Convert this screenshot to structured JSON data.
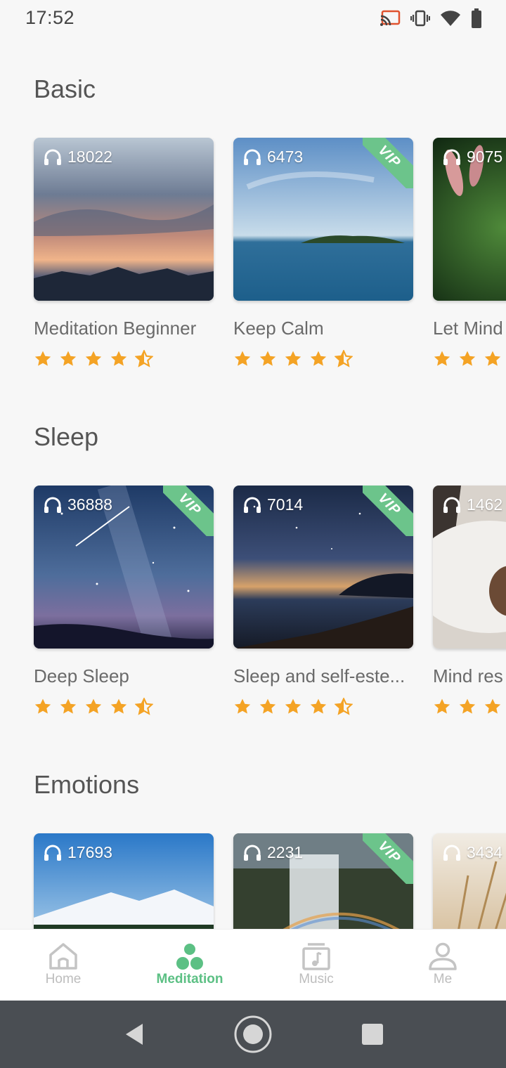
{
  "status_bar": {
    "time": "17:52",
    "icons": [
      "cast-icon",
      "vibrate-icon",
      "wifi-icon",
      "battery-icon"
    ]
  },
  "sections": [
    {
      "title": "Basic",
      "cards": [
        {
          "title": "Meditation Beginner",
          "plays": "18022",
          "vip": false,
          "rating": 4.5,
          "image": "mountain-sunset"
        },
        {
          "title": "Keep Calm",
          "plays": "6473",
          "vip": true,
          "rating": 4.5,
          "image": "ocean-island"
        },
        {
          "title": "Let Mind",
          "plays": "9075",
          "vip": false,
          "rating": 4.5,
          "image": "green-leaves"
        }
      ]
    },
    {
      "title": "Sleep",
      "cards": [
        {
          "title": "Deep Sleep",
          "plays": "36888",
          "vip": true,
          "rating": 4.5,
          "image": "starry-sky"
        },
        {
          "title": "Sleep and self-este...",
          "plays": "7014",
          "vip": true,
          "rating": 4.5,
          "image": "night-beach"
        },
        {
          "title": "Mind res",
          "plays": "1462",
          "vip": false,
          "rating": 4.5,
          "image": "pillow"
        }
      ]
    },
    {
      "title": "Emotions",
      "cards": [
        {
          "title": "",
          "plays": "17693",
          "vip": false,
          "rating": 0,
          "image": "snowy-mountains"
        },
        {
          "title": "",
          "plays": "2231",
          "vip": true,
          "rating": 0,
          "image": "waterfall-rainbow"
        },
        {
          "title": "",
          "plays": "3434",
          "vip": false,
          "rating": 0,
          "image": "wheat-field"
        }
      ]
    }
  ],
  "vip_label": "VIP",
  "bottom_nav": {
    "items": [
      {
        "label": "Home",
        "icon": "home-icon",
        "active": false
      },
      {
        "label": "Meditation",
        "icon": "meditation-icon",
        "active": true
      },
      {
        "label": "Music",
        "icon": "music-icon",
        "active": false
      },
      {
        "label": "Me",
        "icon": "person-icon",
        "active": false
      }
    ]
  },
  "colors": {
    "accent": "#5cc084",
    "star": "#f4a325",
    "vip": "#6cc48b",
    "background": "#f7f7f7",
    "system_nav": "#4a4e53"
  }
}
